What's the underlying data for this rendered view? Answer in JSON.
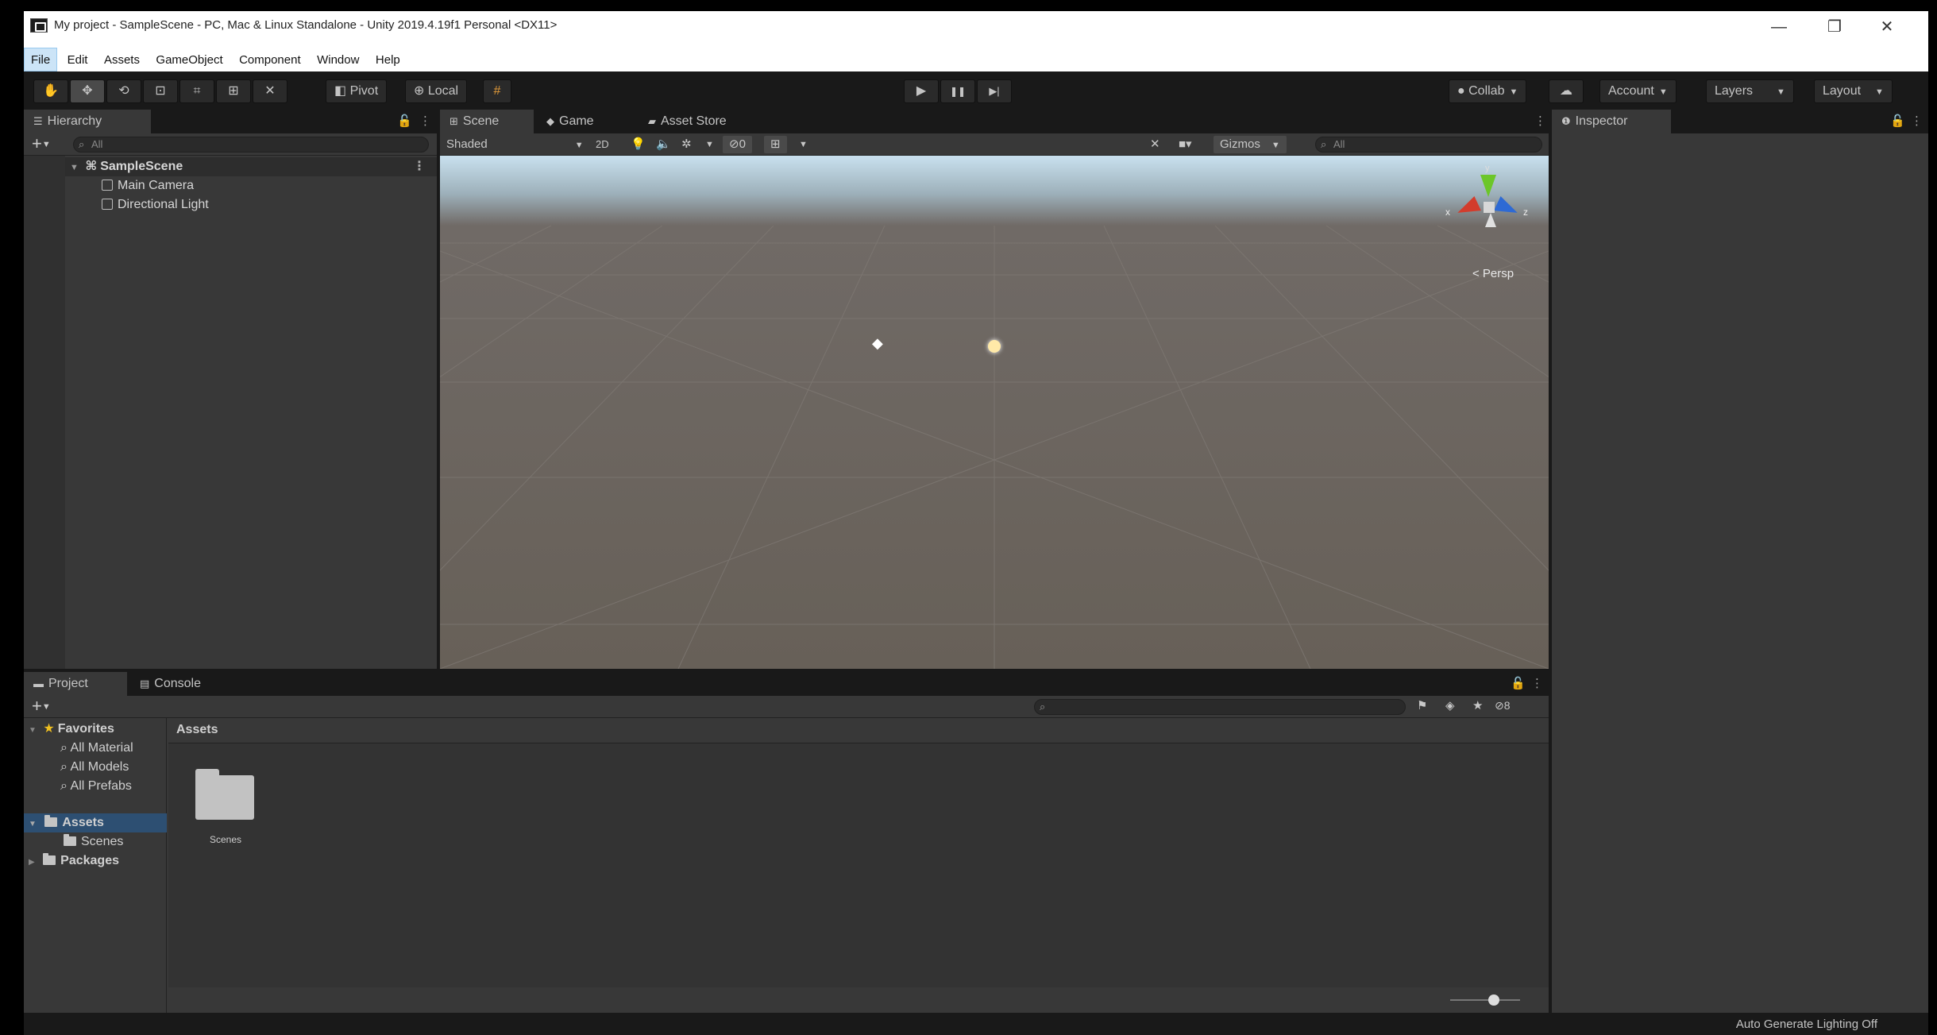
{
  "window": {
    "title": "My project - SampleScene - PC, Mac & Linux Standalone - Unity 2019.4.19f1 Personal <DX11>",
    "minimize": "—",
    "maximize": "❐",
    "close": "✕"
  },
  "menu": [
    "File",
    "Edit",
    "Assets",
    "GameObject",
    "Component",
    "Window",
    "Help"
  ],
  "toolbar": {
    "pivot": "Pivot",
    "local": "Local",
    "collab": "Collab",
    "account": "Account",
    "layers": "Layers",
    "layout": "Layout",
    "play": "▶",
    "pause": "❚❚",
    "step": "▶|"
  },
  "hierarchy": {
    "tab": "Hierarchy",
    "search_placeholder": "All",
    "scene": "SampleScene",
    "items": [
      "Main Camera",
      "Directional Light"
    ]
  },
  "scene_view": {
    "tabs": [
      "Scene",
      "Game",
      "Asset Store"
    ],
    "shading": "Shaded",
    "mode_2d": "2D",
    "hidden_count": "0",
    "gizmos": "Gizmos",
    "search_placeholder": "All",
    "persp_label": "< Persp",
    "axis_x": "x",
    "axis_z": "z",
    "axis_y": "y"
  },
  "inspector": {
    "tab": "Inspector"
  },
  "project": {
    "tabs": [
      "Project",
      "Console"
    ],
    "favorites_label": "Favorites",
    "favorites": [
      "All Material",
      "All Models",
      "All Prefabs"
    ],
    "assets_label": "Assets",
    "asset_children": [
      "Scenes"
    ],
    "packages_label": "Packages",
    "breadcrumb": "Assets",
    "hidden_count": "8",
    "grid_items": [
      "Scenes"
    ]
  },
  "status": {
    "text": "Auto Generate Lighting Off"
  },
  "colors": {
    "accent_selected": "#2d4f72",
    "panel_bg": "#383838",
    "toolbar_bg": "#191919"
  }
}
